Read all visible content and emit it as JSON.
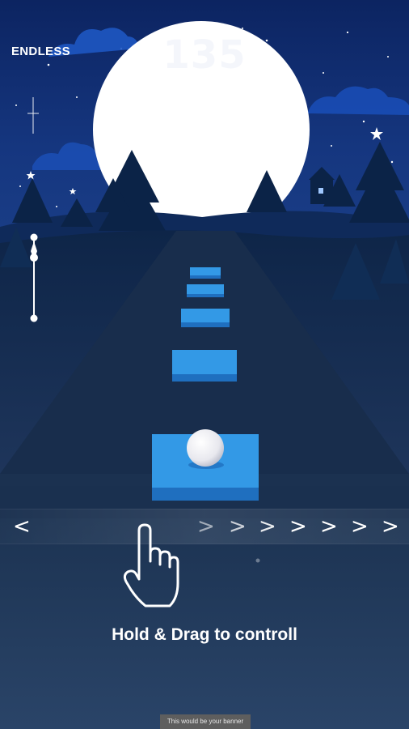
{
  "hud": {
    "mode": "ENDLESS",
    "score": "135",
    "speed_slider_level": 0.75
  },
  "controls": {
    "left_arrow": "<",
    "right_arrows": [
      ">",
      ">",
      ">",
      ">",
      ">",
      ">",
      ">"
    ],
    "instruction": "Hold & Drag to controll"
  },
  "banner": {
    "text": "This would be your banner"
  },
  "colors": {
    "sky_top": "#0d2a6b",
    "sky_bottom": "#173a8a",
    "moon": "#ffffff",
    "trees": "#0b2347",
    "road": "#1a2e4d",
    "tile_top": "#2f8ad8",
    "tile_side": "#1e66b0",
    "ball": "#f2f2f2"
  },
  "icons": [
    "hand-pointer-icon",
    "star-icon"
  ]
}
